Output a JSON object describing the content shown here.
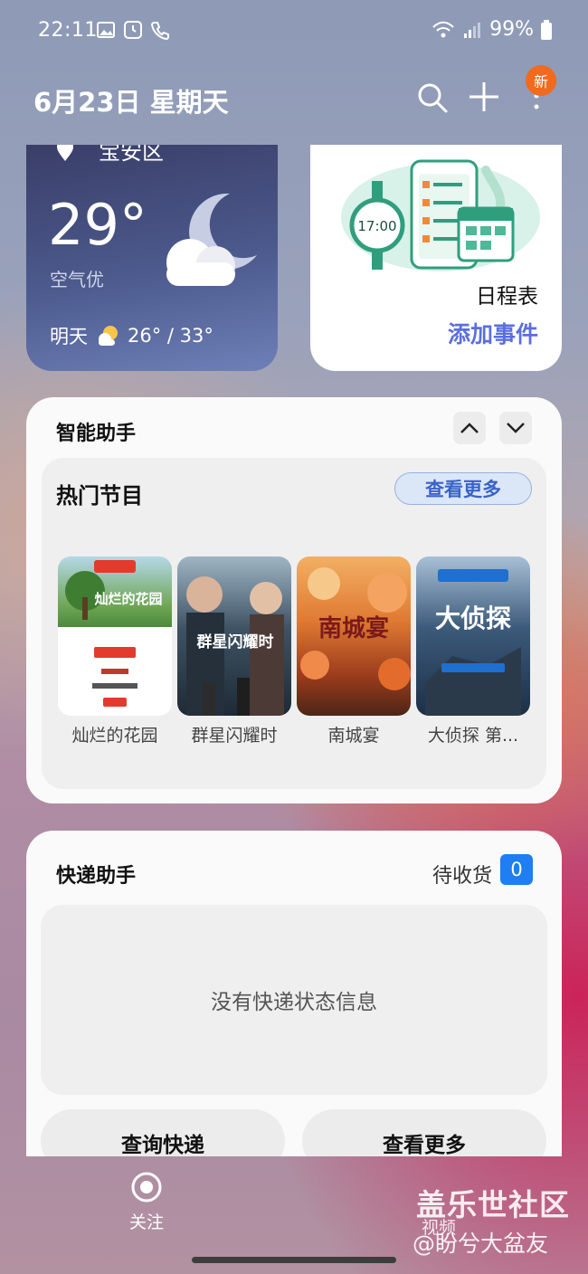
{
  "status_bar": {
    "time": "22:11",
    "battery": "99%",
    "icons": [
      "image-icon",
      "clock-icon",
      "call-icon",
      "wifi-icon",
      "signal-icon",
      "battery-icon"
    ]
  },
  "header": {
    "date": "6月23日 星期天",
    "new_badge": "新"
  },
  "weather": {
    "location": "宝安区",
    "temperature": "29°",
    "air_quality": "空气优",
    "tomorrow_label": "明天",
    "tomorrow_range": "26° / 33°"
  },
  "calendar": {
    "title": "日程表",
    "add_event": "添加事件",
    "clock_text": "17:00"
  },
  "assistant": {
    "title": "智能助手",
    "hot": {
      "title": "热门节目",
      "see_more": "查看更多",
      "shows": [
        {
          "name": "灿烂的花园",
          "poster_text": "灿烂的花园"
        },
        {
          "name": "群星闪耀时",
          "poster_text": "群星闪耀时"
        },
        {
          "name": "南城宴",
          "poster_text": "南城宴"
        },
        {
          "name": "大侦探 第...",
          "poster_text": "大侦探"
        }
      ]
    }
  },
  "express": {
    "title": "快递助手",
    "pending_label": "待收货",
    "pending_count": "0",
    "empty_text": "没有快递状态信息",
    "query_button": "查询快递",
    "more_button": "查看更多"
  },
  "bottom_nav": {
    "follow_label": "关注",
    "video_label": "视频"
  },
  "watermark": {
    "title": "盖乐世社区",
    "subtitle": "@盼兮大盆友"
  },
  "colors": {
    "accent_blue": "#5b6ee0",
    "badge_orange": "#f26a1c",
    "count_blue": "#1e7ef2"
  }
}
